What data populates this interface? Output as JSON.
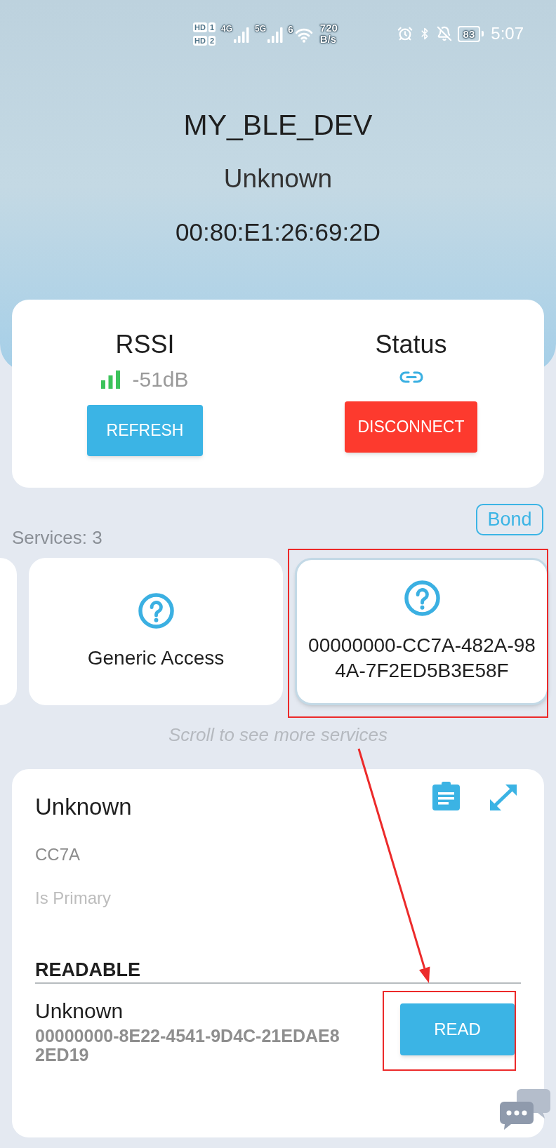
{
  "status_bar": {
    "sim_cards": [
      {
        "badge": "HD",
        "slot": "1"
      },
      {
        "badge": "HD",
        "slot": "2"
      }
    ],
    "networks": [
      "4G",
      "5G"
    ],
    "wifi_generation": "6",
    "speed": "720",
    "speed_unit": "B/s",
    "battery": "83",
    "time": "5:07"
  },
  "device": {
    "name": "MY_BLE_DEV",
    "type": "Unknown",
    "address": "00:80:E1:26:69:2D"
  },
  "connection_card": {
    "rssi_label": "RSSI",
    "rssi_reading": "-51dB",
    "refresh_button": "REFRESH",
    "status_label": "Status",
    "disconnect_button": "DISCONNECT"
  },
  "bond_button": "Bond",
  "services": {
    "count": "Services: 3",
    "cards": [
      {
        "name": "Generic Access",
        "selected": false
      },
      {
        "name": "00000000-CC7A-482A-984A-7F2ED5B3E58F",
        "selected": true
      }
    ],
    "hint": "Scroll to see more services"
  },
  "service_detail": {
    "name": "Unknown",
    "short_uuid": "CC7A",
    "primary": "Is Primary",
    "sections": [
      {
        "title": "READABLE",
        "characteristics": [
          {
            "name": "Unknown",
            "uuid": "00000000-8E22-4541-9D4C-21EDAE82ED19",
            "action": "READ"
          }
        ]
      }
    ]
  }
}
